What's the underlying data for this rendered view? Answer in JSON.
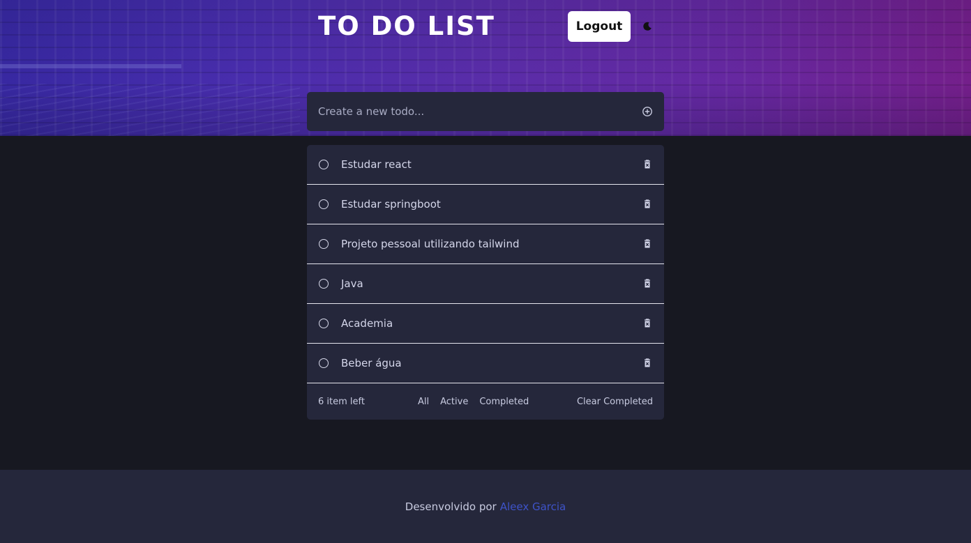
{
  "header": {
    "title": "TO DO LIST",
    "logout_label": "Logout",
    "theme_icon": "moon-icon"
  },
  "new_todo": {
    "placeholder": "Create a new todo...",
    "add_icon": "plus-circle-icon"
  },
  "todos": [
    {
      "text": "Estudar react",
      "completed": false
    },
    {
      "text": "Estudar springboot",
      "completed": false
    },
    {
      "text": "Projeto pessoal utilizando tailwind",
      "completed": false
    },
    {
      "text": "Java",
      "completed": false
    },
    {
      "text": "Academia",
      "completed": false
    },
    {
      "text": "Beber água",
      "completed": false
    }
  ],
  "list_footer": {
    "items_left": "6 item left",
    "filters": [
      "All",
      "Active",
      "Completed"
    ],
    "clear_label": "Clear Completed"
  },
  "page_footer": {
    "text": "Desenvolvido por",
    "author": "Aleex Garcia"
  },
  "colors": {
    "background": "#171821",
    "card": "#25273b",
    "link": "#3e53c9",
    "hero_start": "#3a2aa8",
    "hero_end": "#7a2090"
  }
}
